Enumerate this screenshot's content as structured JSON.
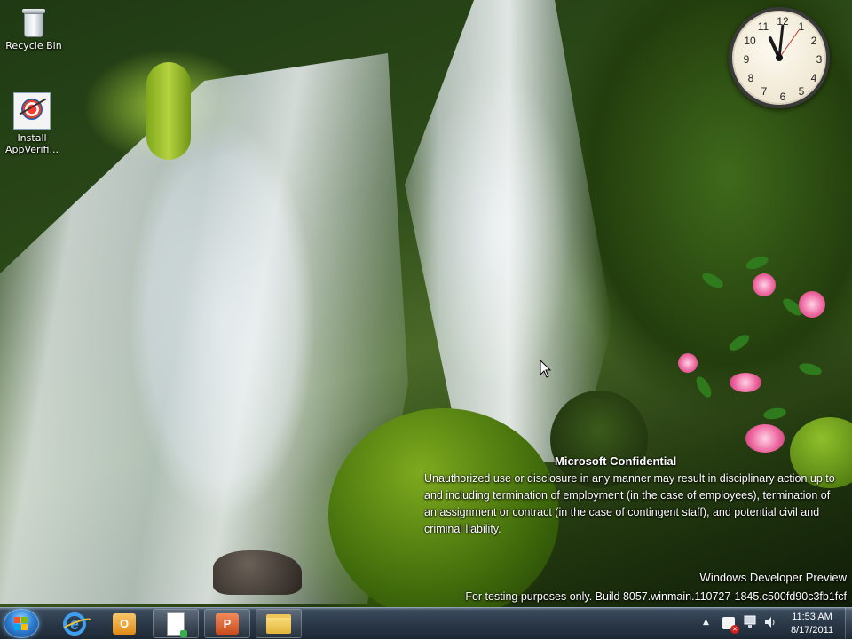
{
  "desktop": {
    "icons": [
      {
        "label": "Recycle Bin",
        "icon": "recycle-bin-icon"
      },
      {
        "label": "Install AppVerifi...",
        "icon": "appverifier-installer-icon"
      }
    ],
    "clock": {
      "hour_numerals": [
        "12",
        "1",
        "2",
        "3",
        "4",
        "5",
        "6",
        "7",
        "8",
        "9",
        "10",
        "11"
      ]
    },
    "watermark": {
      "title": "Microsoft Confidential",
      "body": "Unauthorized use or disclosure in any manner may result in disciplinary action up to and including termination of employment (in the case of employees), termination of an assignment or contract (in the case of contingent staff), and potential civil and criminal liability.",
      "preview": "Windows Developer Preview",
      "build": "For testing purposes only. Build 8057.winmain.110727-1845.c500fd90c3fb1fcf"
    }
  },
  "taskbar": {
    "start_icon": "windows-start-icon",
    "buttons": [
      {
        "icon": "internet-explorer-icon",
        "state": "pinned"
      },
      {
        "icon": "outlook-icon",
        "state": "pinned"
      },
      {
        "icon": "document-icon",
        "state": "running"
      },
      {
        "icon": "powerpoint-icon",
        "state": "running"
      },
      {
        "icon": "file-explorer-icon",
        "state": "running"
      }
    ],
    "tray": {
      "icons": [
        "show-hidden-icons-chevron",
        "action-center-flag-icon",
        "network-icon",
        "volume-icon"
      ],
      "time": "11:53 AM",
      "date": "8/17/2011"
    }
  }
}
